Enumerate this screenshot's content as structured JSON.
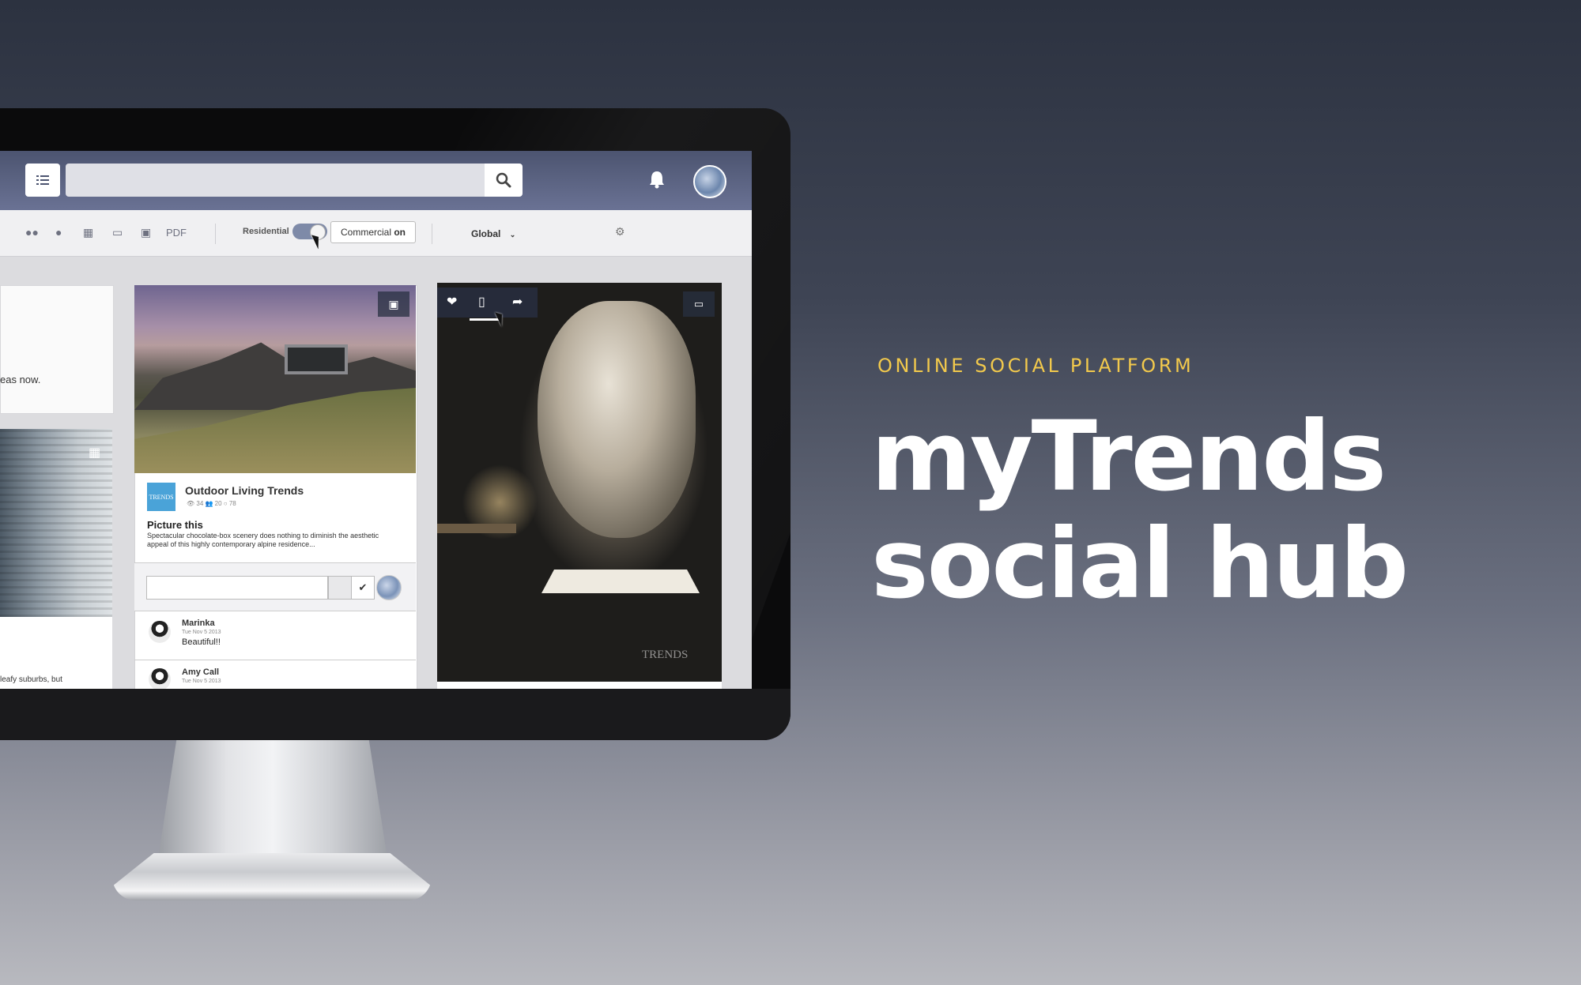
{
  "promo": {
    "tagline": "ONLINE SOCIAL PLATFORM",
    "headline_line1": "myTrends",
    "headline_line2": "social hub",
    "accent_color": "#f2c94c"
  },
  "app": {
    "topbar": {
      "menu_icon": "list-icon",
      "search_placeholder": "",
      "search_icon": "search-icon",
      "notification_icon": "bell-icon",
      "avatar_icon": "user-avatar"
    },
    "filterbar": {
      "icons": [
        "group-icon",
        "person-icon",
        "film-icon",
        "book-icon",
        "image-icon"
      ],
      "pdf_label": "PDF",
      "residential_label": "Residential",
      "toggle_state": "commercial",
      "commercial_tooltip": "Commercial",
      "commercial_tooltip_state": "on",
      "scope_select": "Global",
      "settings_icon": "gear-icon"
    },
    "cards": {
      "left_top_text": "eas now.",
      "left_bottom_text": "leafy suburbs, but",
      "middle": {
        "source_logo": "TRENDS",
        "title": "Outdoor Living Trends",
        "stats": "👁 34  👥 20  ○ 78",
        "headline": "Picture this",
        "description": "Spectacular chocolate-box scenery does nothing to diminish the aesthetic appeal of this highly contemporary alpine residence...",
        "comment_placeholder": "",
        "comments": [
          {
            "name": "Marinka",
            "date": "Tue Nov 5 2013",
            "text": "Beautiful!!"
          },
          {
            "name": "Amy Call",
            "date": "Tue Nov 5 2013",
            "text": ""
          }
        ]
      },
      "right": {
        "actions": [
          "heart-icon",
          "folder-icon",
          "share-icon"
        ],
        "watermark": "TRENDS"
      }
    }
  }
}
